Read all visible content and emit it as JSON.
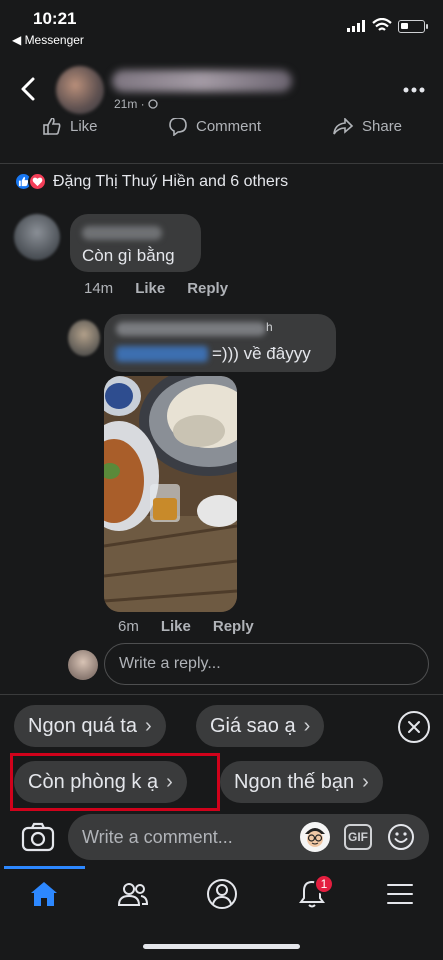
{
  "status_bar": {
    "time": "10:21",
    "back_app": "◀ Messenger",
    "battery_level": 0.35
  },
  "header": {
    "meta": "21m · "
  },
  "actions": {
    "like": "Like",
    "comment": "Comment",
    "share": "Share"
  },
  "reactions": {
    "text": "Đặng Thị Thuý Hiền and 6 others"
  },
  "comment1": {
    "text": "Còn gì bằng",
    "time": "14m",
    "like": "Like",
    "reply": "Reply"
  },
  "reply1": {
    "name_tail": "h",
    "text": "=))) về đâyyy",
    "time": "6m",
    "like": "Like",
    "reply": "Reply"
  },
  "reply_box": {
    "placeholder": "Write a reply..."
  },
  "quick_replies": [
    {
      "label": "Ngon quá ta"
    },
    {
      "label": "Giá sao ạ"
    },
    {
      "label": "Còn phòng k ạ"
    },
    {
      "label": "Ngon thế bạn"
    }
  ],
  "composer": {
    "placeholder": "Write a comment...",
    "gif": "GIF"
  },
  "tabbar": {
    "notification_count": "1"
  },
  "colors": {
    "background": "#18191a",
    "bubble": "#3a3b3c",
    "accent": "#2d88ff",
    "highlight": "#d0021b",
    "badge": "#e41e3f"
  }
}
